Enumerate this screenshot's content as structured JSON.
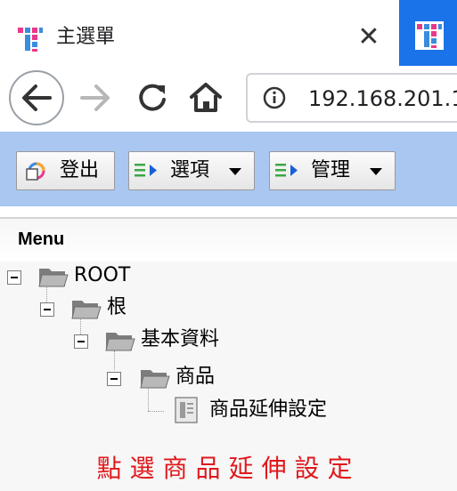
{
  "browser": {
    "tab_title": "主選單",
    "url": "192.168.201.1",
    "accent_color": "#1a73e8"
  },
  "icons": {
    "favicon": "tt-logo-icon",
    "close": "close-icon",
    "back": "back-arrow-icon",
    "forward": "forward-arrow-icon",
    "reload": "reload-icon",
    "home": "home-icon",
    "info": "info-icon"
  },
  "app_toolbar": {
    "background": "#a9c7f0",
    "logout_label": "登出",
    "options_label": "選項",
    "manage_label": "管理"
  },
  "menu": {
    "title": "Menu",
    "tree": [
      {
        "label": "ROOT",
        "level": 0,
        "type": "folder",
        "expanded": true
      },
      {
        "label": "根",
        "level": 1,
        "type": "folder",
        "expanded": true
      },
      {
        "label": "基本資料",
        "level": 2,
        "type": "folder",
        "expanded": true
      },
      {
        "label": "商品",
        "level": 3,
        "type": "folder",
        "expanded": true
      },
      {
        "label": "商品延伸設定",
        "level": 4,
        "type": "document"
      }
    ]
  },
  "instruction": {
    "text": "點選商品延伸設定",
    "color": "#e0181b"
  }
}
